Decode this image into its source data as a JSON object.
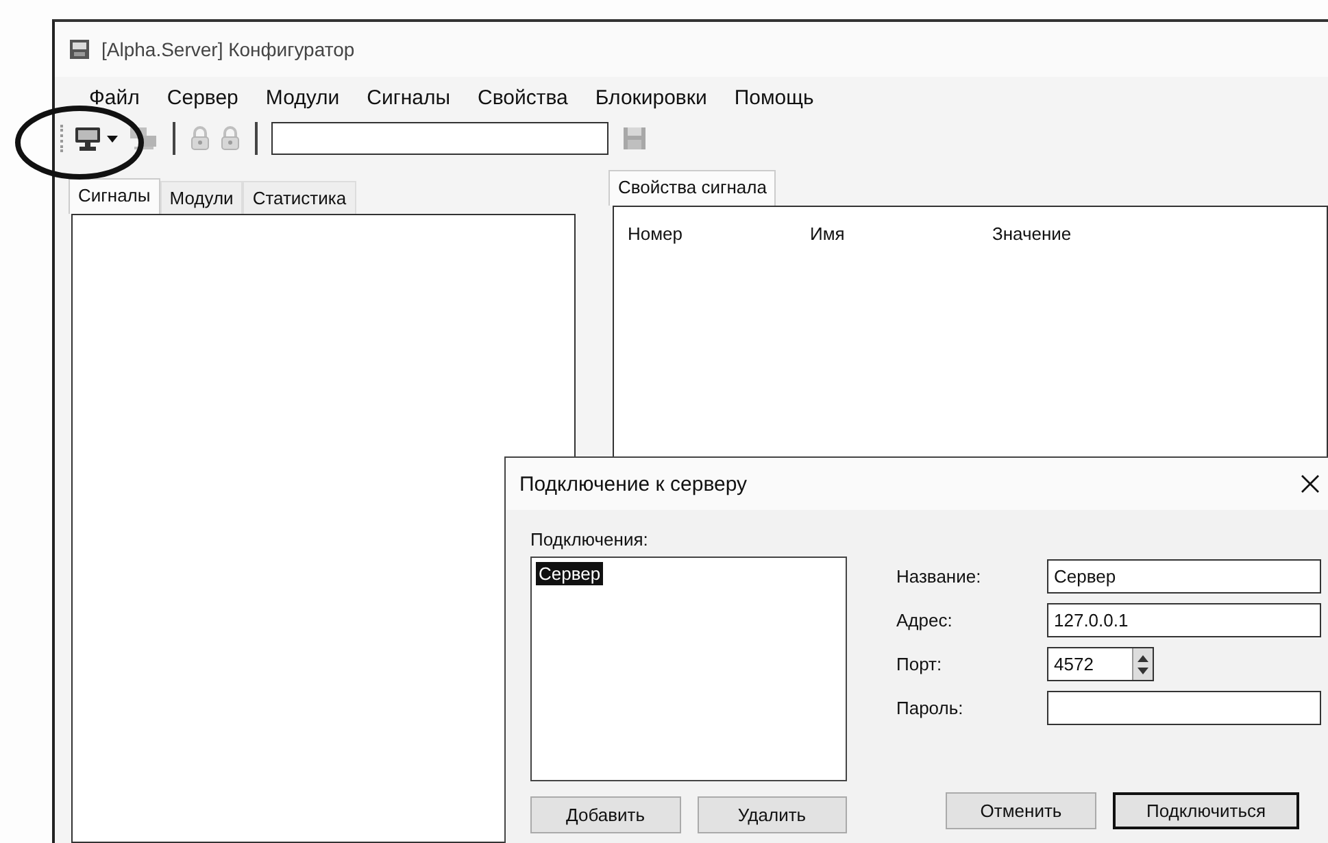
{
  "window": {
    "title": "[Alpha.Server] Конфигуратор"
  },
  "menu": [
    "Файл",
    "Сервер",
    "Модули",
    "Сигналы",
    "Свойства",
    "Блокировки",
    "Помощь"
  ],
  "toolbar": [
    {
      "kind": "connect",
      "disabled": false
    },
    {
      "kind": "network",
      "disabled": true
    },
    {
      "kind": "separator"
    },
    {
      "kind": "lock",
      "disabled": true
    },
    {
      "kind": "lock",
      "disabled": true
    },
    {
      "kind": "separator"
    },
    {
      "kind": "field"
    },
    {
      "kind": "save",
      "disabled": true
    }
  ],
  "left_tabs": [
    {
      "label": "Сигналы",
      "selected": true
    },
    {
      "label": "Модули",
      "selected": false
    },
    {
      "label": "Статистика",
      "selected": false
    }
  ],
  "right_tabs": [
    {
      "label": "Свойства сигнала",
      "selected": true
    }
  ],
  "signal_table": {
    "columns": [
      "Номер",
      "Имя",
      "Значение"
    ]
  },
  "dialog": {
    "title": "Подключение к серверу",
    "list_label": "Подключения:",
    "connections": [
      {
        "label": "Сервер",
        "selected": true
      }
    ],
    "fields": [
      {
        "label": "Название:",
        "value": "Сервер",
        "kind": "text"
      },
      {
        "label": "Адрес:",
        "value": "127.0.0.1",
        "kind": "text"
      },
      {
        "label": "Порт:",
        "value": "4572",
        "kind": "spin"
      },
      {
        "label": "Пароль:",
        "kind": "password"
      }
    ],
    "left_buttons": [
      {
        "label": "Добавить",
        "default": false
      },
      {
        "label": "Удалить",
        "default": false
      }
    ],
    "right_buttons": [
      {
        "label": "Отменить",
        "default": false
      },
      {
        "label": "Подключиться",
        "default": true
      }
    ]
  }
}
